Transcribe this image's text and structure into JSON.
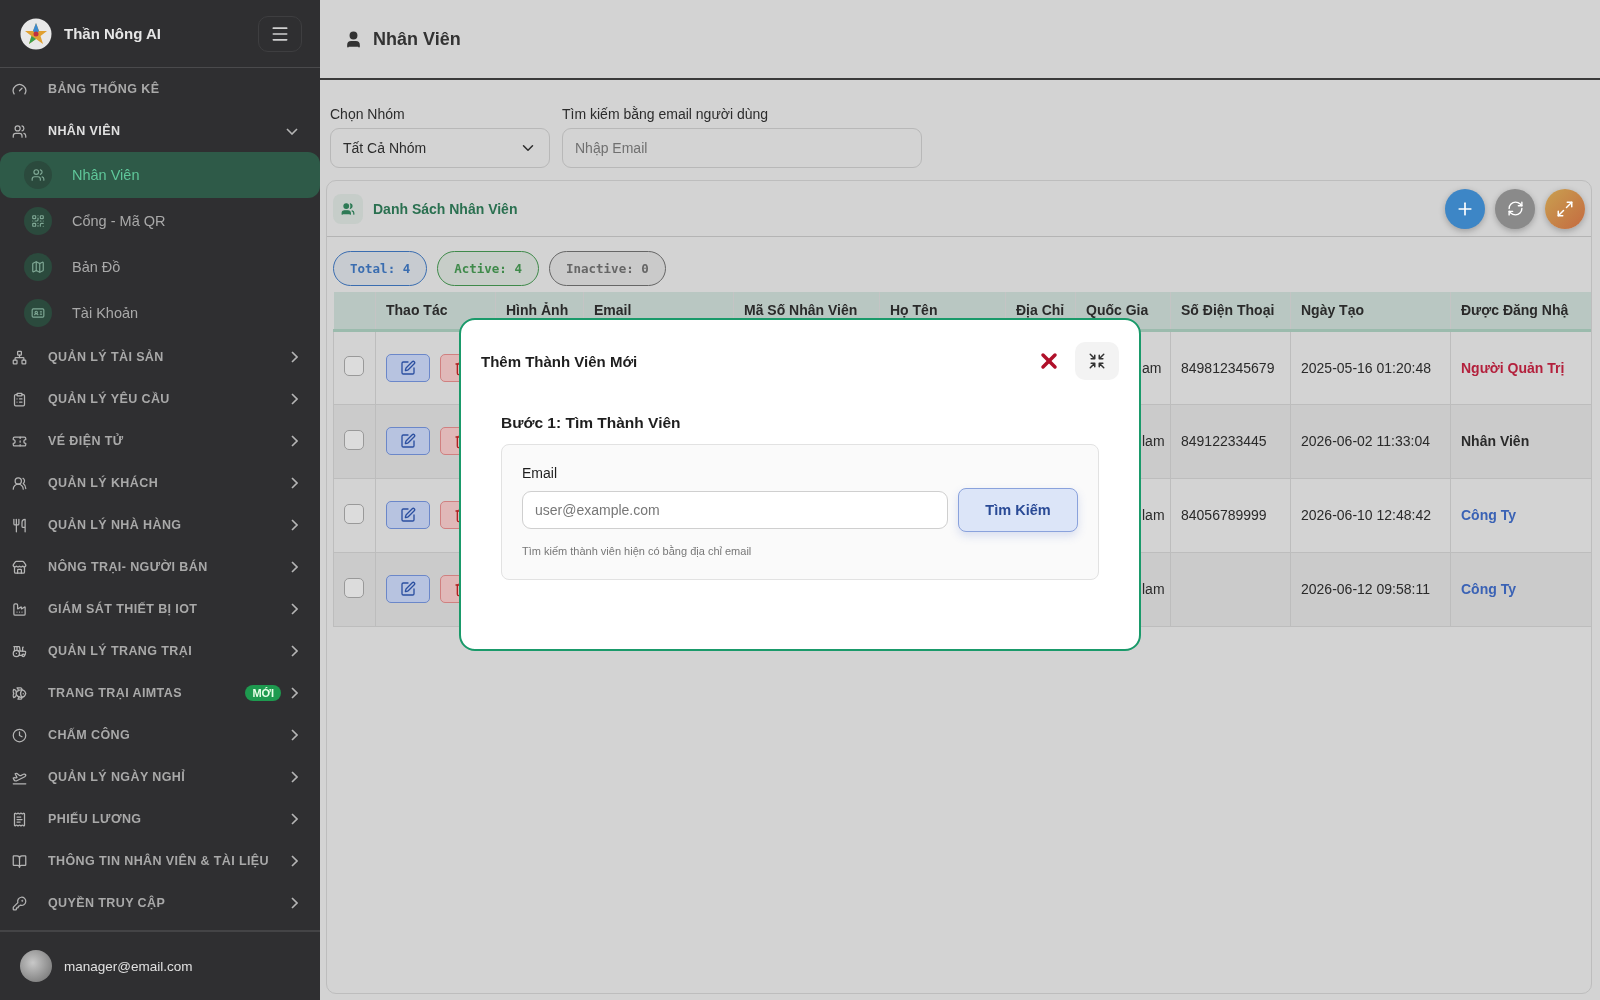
{
  "sidebar": {
    "brand": "Thần Nông AI",
    "items": [
      {
        "label": "BẢNG THỐNG KÊ"
      },
      {
        "label": "NHÂN VIÊN",
        "expanded": true,
        "children": [
          {
            "label": "Nhân Viên",
            "selected": true
          },
          {
            "label": "Cổng - Mã QR",
            "selected": false
          },
          {
            "label": "Bản Đồ",
            "selected": false
          },
          {
            "label": "Tài Khoản",
            "selected": false
          }
        ]
      },
      {
        "label": "QUẢN LÝ TÀI SẢN",
        "expanded": false
      },
      {
        "label": "QUẢN LÝ YÊU CẦU",
        "expanded": false
      },
      {
        "label": "VÉ ĐIỆN TỬ",
        "expanded": false
      },
      {
        "label": "QUẢN LÝ KHÁCH",
        "expanded": false
      },
      {
        "label": "QUẢN LÝ NHÀ HÀNG",
        "expanded": false
      },
      {
        "label": "NÔNG TRẠI- NGƯỜI BÁN",
        "expanded": false
      },
      {
        "label": "GIÁM SÁT THIẾT BỊ IOT",
        "expanded": false
      },
      {
        "label": "QUẢN LÝ TRANG TRẠI",
        "expanded": false
      },
      {
        "label": "TRANG TRẠI AIMTAS",
        "expanded": false,
        "badge": "MỚI"
      },
      {
        "label": "CHẤM CÔNG",
        "expanded": false
      },
      {
        "label": "QUẢN LÝ NGÀY NGHỈ",
        "expanded": false
      },
      {
        "label": "PHIẾU LƯƠNG",
        "expanded": false
      },
      {
        "label": "THÔNG TIN NHÂN VIÊN & TÀI LIỆU",
        "expanded": false
      },
      {
        "label": "QUYỀN TRUY CẬP",
        "expanded": false
      }
    ],
    "user": "manager@email.com"
  },
  "page_title": "Nhân Viên",
  "filters": {
    "group_label": "Chọn Nhóm",
    "group_value": "Tất Cả Nhóm",
    "email_label": "Tìm kiếm bằng email người dùng",
    "email_placeholder": "Nhập Email"
  },
  "list": {
    "title": "Danh Sách Nhân Viên",
    "stats": [
      {
        "label": "Total: 4",
        "color": "#3a6db0"
      },
      {
        "label": "Active: 4",
        "color": "#3f8a4a"
      },
      {
        "label": "Inactive: 0",
        "color": "#666666"
      }
    ],
    "columns": [
      "Thao Tác",
      "Hình Ảnh",
      "Email",
      "Mã Số Nhân Viên",
      "Họ Tên",
      "Địa Chỉ",
      "Quốc Gia",
      "Số Điện Thoại",
      "Ngày Tạo",
      "Được Đăng Nhậ"
    ],
    "rows": [
      {
        "checked": false,
        "country": "am",
        "phone": "849812345679",
        "created": "2025-05-16 01:20:48",
        "role": "Người Quản Trị",
        "color": "#b3203c"
      },
      {
        "checked": false,
        "country": "lam",
        "phone": "84912233445",
        "created": "2026-06-02 11:33:04",
        "role": "Nhân Viên",
        "color": "#2a2a2a"
      },
      {
        "checked": false,
        "country": "lam",
        "phone": "84056789999",
        "created": "2026-06-10 12:48:42",
        "role": "Công Ty",
        "color": "#3a62b5"
      },
      {
        "checked": false,
        "country": "lam",
        "created": "2026-06-12 09:58:11",
        "role": "Công Ty",
        "color": "#3a62b5"
      }
    ]
  },
  "modal": {
    "title": "Thêm Thành Viên Mới",
    "step_title": "Bước 1: Tìm Thành Viên",
    "email_label": "Email",
    "email_placeholder": "user@example.com",
    "search_button": "Tìm Kiếm",
    "hint": "Tìm kiếm thành viên hiện có bằng địa chỉ email"
  }
}
